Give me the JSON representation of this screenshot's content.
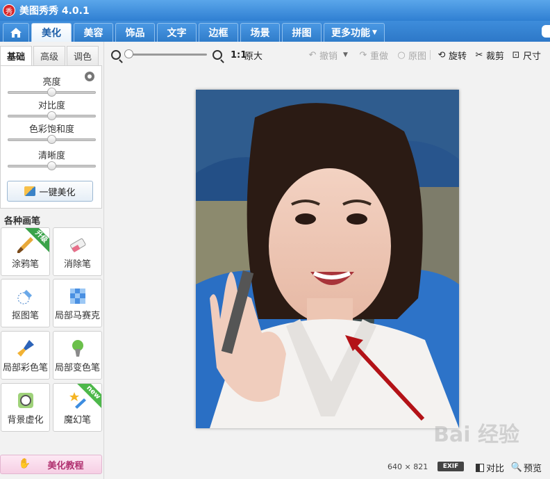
{
  "app": {
    "logo": "秀",
    "title": "美图秀秀 4.0.1"
  },
  "tabs": [
    {
      "id": "beauty",
      "label": "美化",
      "active": true
    },
    {
      "id": "face",
      "label": "美容"
    },
    {
      "id": "decor",
      "label": "饰品"
    },
    {
      "id": "text",
      "label": "文字"
    },
    {
      "id": "frame",
      "label": "边框"
    },
    {
      "id": "scene",
      "label": "场景"
    },
    {
      "id": "collage",
      "label": "拼图"
    },
    {
      "id": "more",
      "label": "更多功能"
    }
  ],
  "left_panel": {
    "subtabs": [
      {
        "label": "基础",
        "active": true
      },
      {
        "label": "高级"
      },
      {
        "label": "调色"
      }
    ],
    "sliders": [
      {
        "label": "亮度",
        "value": 0.5
      },
      {
        "label": "对比度",
        "value": 0.5
      },
      {
        "label": "色彩饱和度",
        "value": 0.5
      },
      {
        "label": "清晰度",
        "value": 0.5
      }
    ],
    "onekey_label": "一键美化",
    "brushes_title": "各种画笔",
    "tools": [
      {
        "label": "涂鸦笔",
        "badge": "升级",
        "icon": "paintbrush-icon"
      },
      {
        "label": "消除笔",
        "icon": "eraser-icon"
      },
      {
        "label": "抠图笔",
        "icon": "cutout-pen-icon"
      },
      {
        "label": "局部马赛克",
        "icon": "mosaic-icon"
      },
      {
        "label": "局部彩色笔",
        "icon": "color-brush-icon"
      },
      {
        "label": "局部变色笔",
        "icon": "recolor-brush-icon"
      },
      {
        "label": "背景虚化",
        "icon": "blur-background-icon"
      },
      {
        "label": "魔幻笔",
        "badge": "new",
        "icon": "magic-pen-icon"
      }
    ],
    "tutorial_label": "美化教程"
  },
  "toolbar": {
    "ratio_label": "1:1",
    "original_size_label": "原大",
    "undo_label": "撤销",
    "redo_label": "重做",
    "original_label": "原图",
    "rotate_label": "旋转",
    "crop_label": "裁剪",
    "resize_label": "尺寸",
    "zoom_value": 0
  },
  "status": {
    "width": "640",
    "times": "×",
    "height": "821",
    "exif_label": "EXIF",
    "compare_label": "对比",
    "preview_label": "预览"
  },
  "watermark": "Bai 经验",
  "colors": {
    "accent": "#2f7fd2",
    "arrow": "#b31217"
  }
}
